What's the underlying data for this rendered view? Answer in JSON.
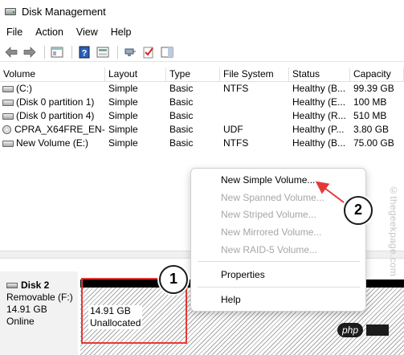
{
  "window": {
    "title": "Disk Management"
  },
  "menu": [
    "File",
    "Action",
    "View",
    "Help"
  ],
  "toolbar": {
    "buttons": [
      "back-arrow-icon",
      "forward-arrow-icon",
      "console-tree-icon",
      "help-icon",
      "properties-icon",
      "connect-icon",
      "check-icon",
      "action-pane-icon"
    ]
  },
  "table": {
    "headers": [
      "Volume",
      "Layout",
      "Type",
      "File System",
      "Status",
      "Capacity"
    ],
    "rows": [
      {
        "volume": "(C:)",
        "layout": "Simple",
        "type": "Basic",
        "fs": "NTFS",
        "status": "Healthy (B...",
        "capacity": "99.39 GB",
        "icon": "disk"
      },
      {
        "volume": "(Disk 0 partition 1)",
        "layout": "Simple",
        "type": "Basic",
        "fs": "",
        "status": "Healthy (E...",
        "capacity": "100 MB",
        "icon": "disk"
      },
      {
        "volume": "(Disk 0 partition 4)",
        "layout": "Simple",
        "type": "Basic",
        "fs": "",
        "status": "Healthy (R...",
        "capacity": "510 MB",
        "icon": "disk"
      },
      {
        "volume": "CPRA_X64FRE_EN-...",
        "layout": "Simple",
        "type": "Basic",
        "fs": "UDF",
        "status": "Healthy (P...",
        "capacity": "3.80 GB",
        "icon": "cd"
      },
      {
        "volume": "New Volume (E:)",
        "layout": "Simple",
        "type": "Basic",
        "fs": "NTFS",
        "status": "Healthy (B...",
        "capacity": "75.00 GB",
        "icon": "disk"
      }
    ]
  },
  "context_menu": {
    "items": [
      {
        "label": "New Simple Volume...",
        "enabled": true
      },
      {
        "label": "New Spanned Volume...",
        "enabled": false
      },
      {
        "label": "New Striped Volume...",
        "enabled": false
      },
      {
        "label": "New Mirrored Volume...",
        "enabled": false
      },
      {
        "label": "New RAID-5 Volume...",
        "enabled": false
      },
      {
        "label": "Properties",
        "enabled": true
      },
      {
        "label": "Help",
        "enabled": true
      }
    ]
  },
  "disk": {
    "name": "Disk 2",
    "type": "Removable (F:)",
    "size": "14.91 GB",
    "status": "Online",
    "partition": {
      "size": "14.91 GB",
      "state": "Unallocated"
    }
  },
  "annotations": {
    "step1": "1",
    "step2": "2"
  },
  "watermark": "©thegeekpage.com",
  "php_badge": "php",
  "colors": {
    "highlight_box": "#e53935",
    "badge_border": "#1a1a1a"
  }
}
